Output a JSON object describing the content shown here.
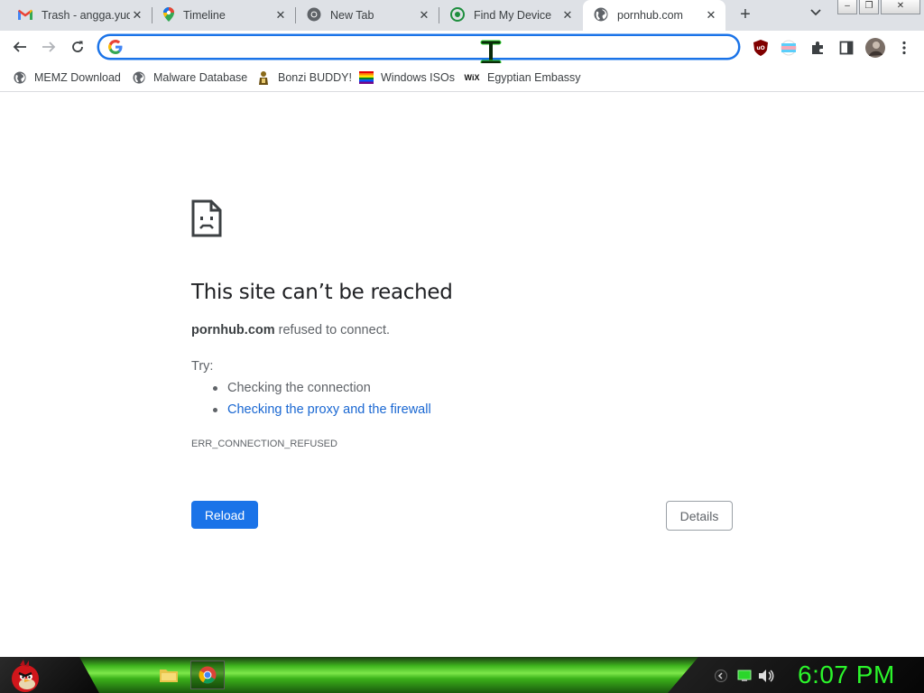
{
  "tabs": [
    {
      "title": "Trash - angga.yud",
      "icon": "gmail-icon",
      "close": "✕"
    },
    {
      "title": "Timeline",
      "icon": "maps-pin-icon",
      "close": "✕"
    },
    {
      "title": "New Tab",
      "icon": "chrome-icon",
      "close": "✕"
    },
    {
      "title": "Find My Device",
      "icon": "find-my-device-icon",
      "close": "✕"
    },
    {
      "title": "pornhub.com",
      "icon": "globe-icon",
      "close": "✕",
      "active": true
    }
  ],
  "new_tab": "+",
  "tab_search": "⌄",
  "window_controls": {
    "minimize": "–",
    "restore": "❐",
    "close": "✕"
  },
  "omnibox": {
    "value": "",
    "placeholder": ""
  },
  "bookmarks": [
    {
      "label": "MEMZ Download",
      "icon": "globe-icon"
    },
    {
      "label": "Malware Database",
      "icon": "globe-icon"
    },
    {
      "label": "Bonzi BUDDY!",
      "icon": "bonzi-icon"
    },
    {
      "label": "Windows ISOs",
      "icon": "rainbow-flag-icon"
    },
    {
      "label": "Egyptian Embassy",
      "icon": "wix-icon",
      "icon_text": "WiX"
    }
  ],
  "error_page": {
    "title": "This site can’t be reached",
    "domain": "pornhub.com",
    "description_suffix": " refused to connect.",
    "try_label": "Try:",
    "suggestions": [
      "Checking the connection",
      "Checking the proxy and the firewall"
    ],
    "error_code": "ERR_CONNECTION_REFUSED",
    "reload_label": "Reload",
    "details_label": "Details"
  },
  "taskbar": {
    "clock": "6:07 PM"
  },
  "colors": {
    "accent": "#1a73e8",
    "link": "#1967d2",
    "clock": "#2bf52b"
  }
}
